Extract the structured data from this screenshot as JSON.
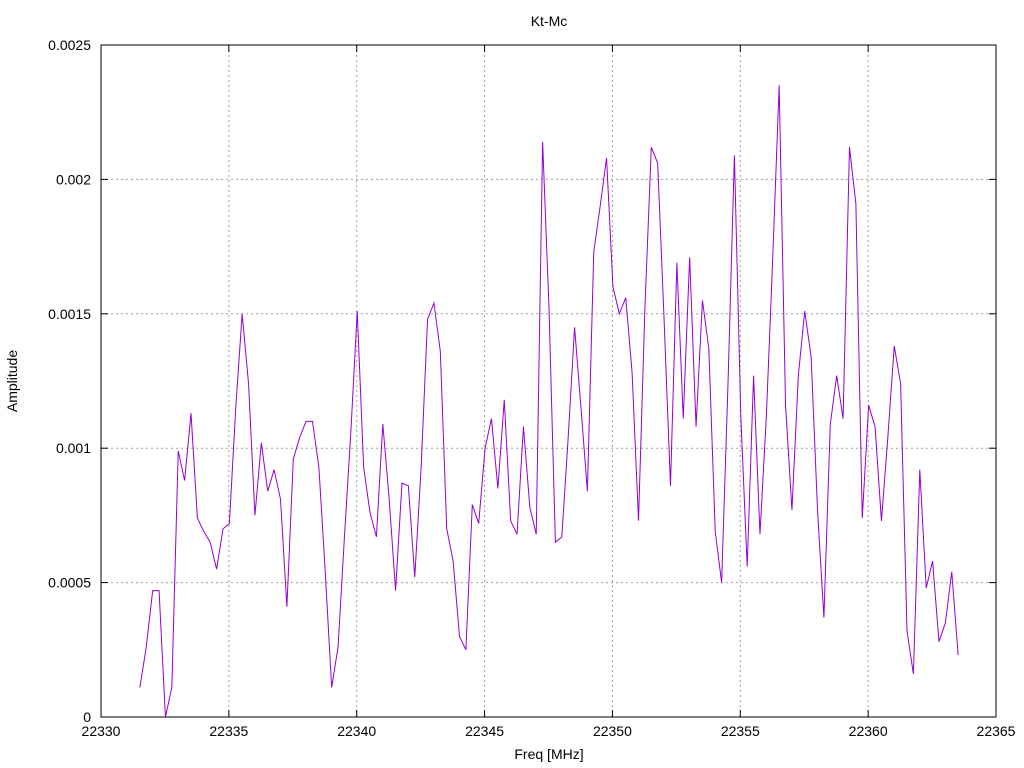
{
  "chart_data": {
    "type": "line",
    "title": "Kt-Mc",
    "xlabel": "Freq [MHz]",
    "ylabel": "Amplitude",
    "xlim": [
      22330,
      22365
    ],
    "ylim": [
      0,
      0.0025
    ],
    "x_ticks": [
      22330,
      22335,
      22340,
      22345,
      22350,
      22355,
      22360,
      22365
    ],
    "y_ticks": [
      0,
      0.0005,
      0.001,
      0.0015,
      0.002,
      0.0025
    ],
    "x_tick_labels": [
      "22330",
      "22335",
      "22340",
      "22345",
      "22350",
      "22355",
      "22360",
      "22365"
    ],
    "y_tick_labels": [
      "0",
      "0.0005",
      "0.001",
      "0.0015",
      "0.002",
      "0.0025"
    ],
    "grid": true,
    "series": [
      {
        "color": "#9400d3",
        "points": [
          [
            22331.52,
            0.00011
          ],
          [
            22331.77,
            0.00026
          ],
          [
            22332.02,
            0.00047
          ],
          [
            22332.27,
            0.00047
          ],
          [
            22332.52,
            0.0
          ],
          [
            22332.77,
            0.00011
          ],
          [
            22333.02,
            0.00099
          ],
          [
            22333.27,
            0.00088
          ],
          [
            22333.52,
            0.00113
          ],
          [
            22333.77,
            0.00074
          ],
          [
            22334.02,
            0.00069
          ],
          [
            22334.27,
            0.00065
          ],
          [
            22334.52,
            0.00055
          ],
          [
            22334.77,
            0.0007
          ],
          [
            22335.02,
            0.00072
          ],
          [
            22335.27,
            0.00115
          ],
          [
            22335.52,
            0.0015
          ],
          [
            22335.77,
            0.00124
          ],
          [
            22336.02,
            0.00075
          ],
          [
            22336.27,
            0.00102
          ],
          [
            22336.52,
            0.00084
          ],
          [
            22336.77,
            0.00092
          ],
          [
            22337.02,
            0.00081
          ],
          [
            22337.27,
            0.00041
          ],
          [
            22337.52,
            0.00096
          ],
          [
            22337.77,
            0.00104
          ],
          [
            22338.02,
            0.0011
          ],
          [
            22338.27,
            0.0011
          ],
          [
            22338.52,
            0.00093
          ],
          [
            22338.77,
            0.00054
          ],
          [
            22339.02,
            0.00011
          ],
          [
            22339.27,
            0.00026
          ],
          [
            22339.52,
            0.00067
          ],
          [
            22339.77,
            0.00106
          ],
          [
            22340.02,
            0.00151
          ],
          [
            22340.27,
            0.00093
          ],
          [
            22340.52,
            0.00076
          ],
          [
            22340.77,
            0.00067
          ],
          [
            22341.02,
            0.00109
          ],
          [
            22341.27,
            0.00081
          ],
          [
            22341.52,
            0.00047
          ],
          [
            22341.77,
            0.00087
          ],
          [
            22342.02,
            0.00086
          ],
          [
            22342.27,
            0.00052
          ],
          [
            22342.52,
            0.00093
          ],
          [
            22342.77,
            0.00148
          ],
          [
            22343.02,
            0.00154
          ],
          [
            22343.27,
            0.00136
          ],
          [
            22343.52,
            0.0007
          ],
          [
            22343.77,
            0.00058
          ],
          [
            22344.02,
            0.0003
          ],
          [
            22344.27,
            0.00025
          ],
          [
            22344.52,
            0.00079
          ],
          [
            22344.77,
            0.00072
          ],
          [
            22345.02,
            0.001
          ],
          [
            22345.27,
            0.00111
          ],
          [
            22345.52,
            0.00085
          ],
          [
            22345.77,
            0.00118
          ],
          [
            22346.02,
            0.00073
          ],
          [
            22346.27,
            0.00068
          ],
          [
            22346.52,
            0.00108
          ],
          [
            22346.77,
            0.00078
          ],
          [
            22347.02,
            0.00068
          ],
          [
            22347.27,
            0.00214
          ],
          [
            22347.52,
            0.00152
          ],
          [
            22347.77,
            0.00065
          ],
          [
            22348.02,
            0.00067
          ],
          [
            22348.27,
            0.00104
          ],
          [
            22348.52,
            0.00145
          ],
          [
            22348.77,
            0.00115
          ],
          [
            22349.02,
            0.00084
          ],
          [
            22349.27,
            0.00173
          ],
          [
            22349.52,
            0.0019
          ],
          [
            22349.77,
            0.00208
          ],
          [
            22350.02,
            0.0016
          ],
          [
            22350.27,
            0.0015
          ],
          [
            22350.52,
            0.00156
          ],
          [
            22350.77,
            0.00128
          ],
          [
            22351.02,
            0.00073
          ],
          [
            22351.27,
            0.00152
          ],
          [
            22351.52,
            0.00212
          ],
          [
            22351.77,
            0.00206
          ],
          [
            22352.02,
            0.00148
          ],
          [
            22352.27,
            0.00086
          ],
          [
            22352.52,
            0.00169
          ],
          [
            22352.77,
            0.00111
          ],
          [
            22353.02,
            0.00171
          ],
          [
            22353.27,
            0.00108
          ],
          [
            22353.52,
            0.00155
          ],
          [
            22353.77,
            0.00137
          ],
          [
            22354.02,
            0.00069
          ],
          [
            22354.27,
            0.0005
          ],
          [
            22354.52,
            0.00124
          ],
          [
            22354.77,
            0.00209
          ],
          [
            22355.02,
            0.00112
          ],
          [
            22355.27,
            0.00056
          ],
          [
            22355.52,
            0.00127
          ],
          [
            22355.77,
            0.00068
          ],
          [
            22356.02,
            0.00112
          ],
          [
            22356.27,
            0.00171
          ],
          [
            22356.52,
            0.00235
          ],
          [
            22356.77,
            0.00116
          ],
          [
            22357.02,
            0.00077
          ],
          [
            22357.27,
            0.00127
          ],
          [
            22357.52,
            0.00151
          ],
          [
            22357.77,
            0.00134
          ],
          [
            22358.02,
            0.00077
          ],
          [
            22358.27,
            0.00037
          ],
          [
            22358.52,
            0.00109
          ],
          [
            22358.77,
            0.00127
          ],
          [
            22359.02,
            0.00111
          ],
          [
            22359.27,
            0.00212
          ],
          [
            22359.52,
            0.00191
          ],
          [
            22359.77,
            0.00074
          ],
          [
            22360.02,
            0.00116
          ],
          [
            22360.27,
            0.00108
          ],
          [
            22360.52,
            0.00073
          ],
          [
            22360.77,
            0.00104
          ],
          [
            22361.02,
            0.00138
          ],
          [
            22361.27,
            0.00124
          ],
          [
            22361.52,
            0.00032
          ],
          [
            22361.77,
            0.00016
          ],
          [
            22362.02,
            0.00092
          ],
          [
            22362.27,
            0.00048
          ],
          [
            22362.52,
            0.00058
          ],
          [
            22362.77,
            0.00028
          ],
          [
            22363.02,
            0.00035
          ],
          [
            22363.27,
            0.00054
          ],
          [
            22363.52,
            0.00023
          ]
        ]
      }
    ]
  }
}
